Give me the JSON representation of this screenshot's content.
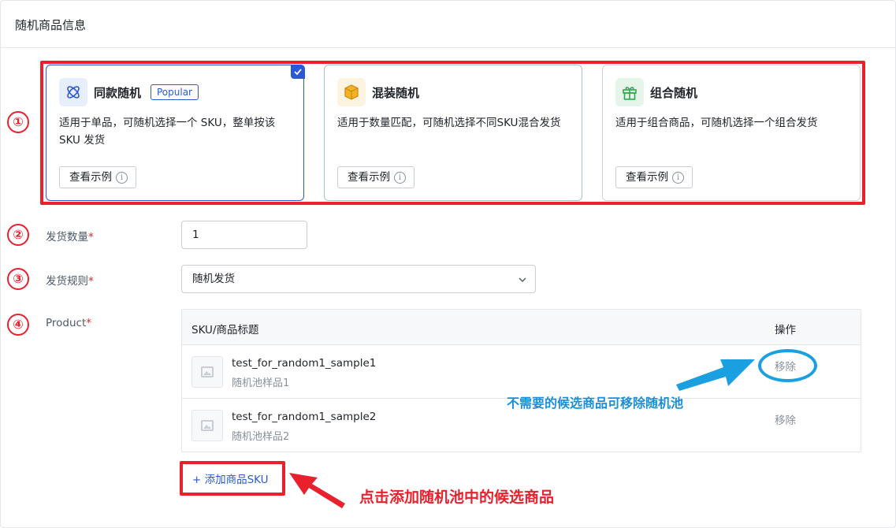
{
  "panel": {
    "title": "随机商品信息"
  },
  "cards": [
    {
      "icon": "atom-icon",
      "title": "同款随机",
      "badge": "Popular",
      "desc": "适用于单品，可随机选择一个 SKU，整单按该 SKU 发货",
      "button": "查看示例",
      "selected": true
    },
    {
      "icon": "box-icon",
      "title": "混装随机",
      "desc": "适用于数量匹配，可随机选择不同SKU混合发货",
      "button": "查看示例",
      "selected": false
    },
    {
      "icon": "gift-icon",
      "title": "组合随机",
      "desc": "适用于组合商品，可随机选择一个组合发货",
      "button": "查看示例",
      "selected": false
    }
  ],
  "steps": [
    "①",
    "②",
    "③",
    "④"
  ],
  "form": {
    "quantity_label": "发货数量",
    "quantity_value": "1",
    "rule_label": "发货规则",
    "rule_value": "随机发货",
    "product_label": "Product",
    "required_mark": "*"
  },
  "table": {
    "col_title": "SKU/商品标题",
    "col_action": "操作",
    "rows": [
      {
        "name": "test_for_random1_sample1",
        "sub": "随机池样品1",
        "action": "移除"
      },
      {
        "name": "test_for_random1_sample2",
        "sub": "随机池样品2",
        "action": "移除"
      }
    ]
  },
  "add_sku": {
    "icon": "+",
    "label": "添加商品SKU"
  },
  "annotations": {
    "remove_tip": "不需要的候选商品可移除随机池",
    "add_tip": "点击添加随机池中的候选商品"
  },
  "colors": {
    "accent": "#2a59d6",
    "annotation_red": "#e8212d",
    "annotation_blue": "#1aa0e0"
  }
}
